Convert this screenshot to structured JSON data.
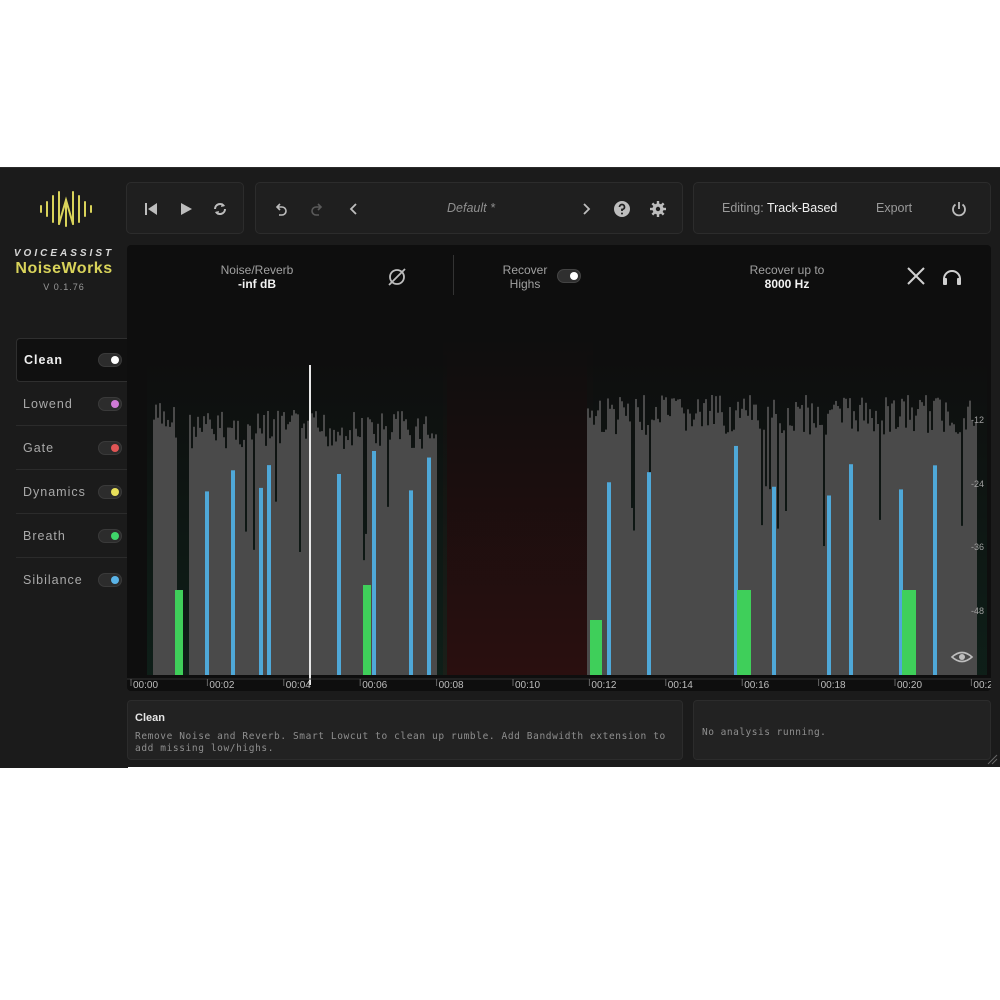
{
  "brand": {
    "top": "VOICEASSIST",
    "name": "NoiseWorks",
    "version": "V 0.1.76"
  },
  "modules": [
    {
      "label": "Clean",
      "dot_color": "#ffffff",
      "active": true
    },
    {
      "label": "Lowend",
      "dot_color": "#d07ad6",
      "active": false
    },
    {
      "label": "Gate",
      "dot_color": "#e05555",
      "active": false
    },
    {
      "label": "Dynamics",
      "dot_color": "#e8e05a",
      "active": false
    },
    {
      "label": "Breath",
      "dot_color": "#3fd46a",
      "active": false
    },
    {
      "label": "Sibilance",
      "dot_color": "#5ab4e8",
      "active": false
    }
  ],
  "transport": {
    "icons": [
      "skip-back-icon",
      "play-icon",
      "loop-icon"
    ]
  },
  "preset": {
    "name": "Default *",
    "icons": [
      "undo-icon",
      "redo-icon",
      "prev-preset-icon",
      "next-preset-icon",
      "help-icon",
      "settings-icon"
    ]
  },
  "topright": {
    "editing_label": "Editing:",
    "editing_value": "Track-Based",
    "export_label": "Export",
    "power_icon": "power-icon"
  },
  "display": {
    "noise_label": "Noise/Reverb",
    "noise_value": "-inf dB",
    "recover_label_1": "Recover",
    "recover_label_2": "Highs",
    "recover_upto_label": "Recover up to",
    "recover_upto_value": "8000 Hz",
    "db_labels": [
      "-12",
      "-24",
      "-36",
      "-48"
    ],
    "time_labels": [
      "00:00",
      "00:02",
      "00:04",
      "00:06",
      "00:08",
      "00:10",
      "00:12",
      "00:14",
      "00:16",
      "00:18",
      "00:20",
      "00:2"
    ],
    "colors": {
      "waveform": "#4a4a4a",
      "sibilance": "#4fa8d8",
      "breath": "#3fcf5a",
      "playhead": "#e8e8e8",
      "silence_tint": "#2a0f0f"
    }
  },
  "info": {
    "title": "Clean",
    "description": "Remove Noise and Reverb. Smart Lowcut to clean up rumble. Add Bandwidth extension to add missing low/highs."
  },
  "analysis": {
    "text": "No analysis running."
  }
}
